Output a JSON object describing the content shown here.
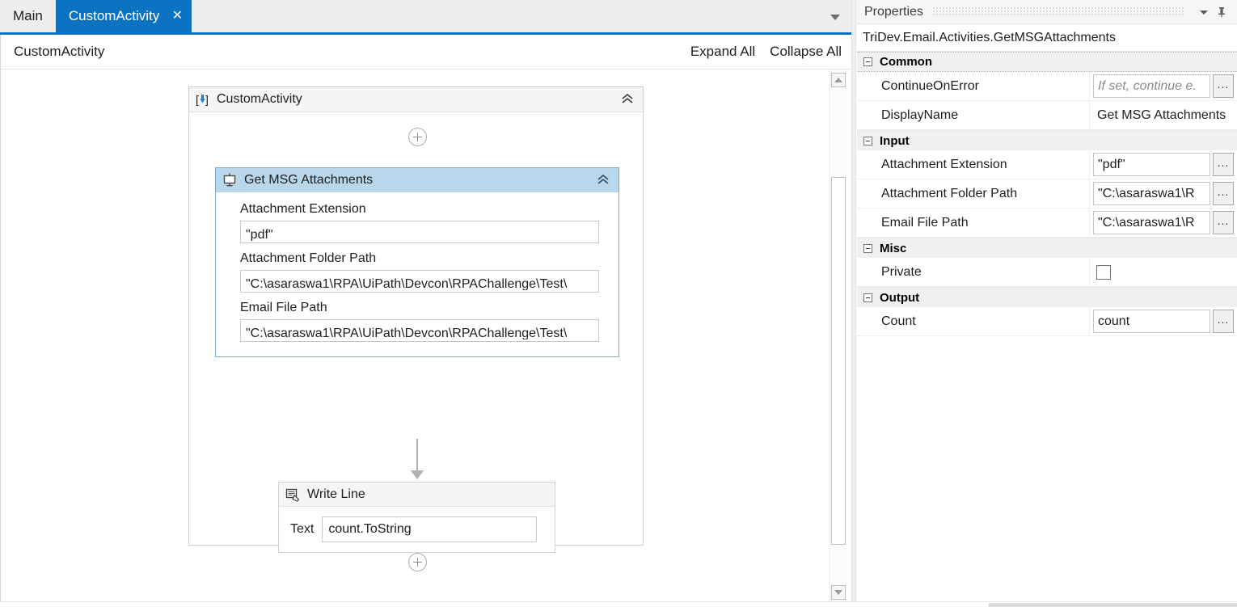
{
  "tabs": [
    {
      "label": "Main",
      "active": false,
      "closable": false
    },
    {
      "label": "CustomActivity",
      "active": true,
      "closable": true,
      "close_glyph": "✕"
    }
  ],
  "tab_overflow_icon": "chevron-down-icon",
  "designer": {
    "breadcrumb": "CustomActivity",
    "expand_all_label": "Expand All",
    "collapse_all_label": "Collapse All",
    "sequence": {
      "title": "CustomActivity",
      "icon": "sequence-icon",
      "collapse_glyph": "«"
    },
    "activity_getmsg": {
      "title": "Get MSG Attachments",
      "icon": "get-msg-attachments-icon",
      "collapse_glyph": "«",
      "fields": [
        {
          "label": "Attachment Extension",
          "value": "\"pdf\""
        },
        {
          "label": "Attachment Folder Path",
          "value": "\"C:\\asaraswa1\\RPA\\UiPath\\Devcon\\RPAChallenge\\Test\\"
        },
        {
          "label": "Email File Path",
          "value": "\"C:\\asaraswa1\\RPA\\UiPath\\Devcon\\RPAChallenge\\Test\\"
        }
      ]
    },
    "activity_writeline": {
      "title": "Write Line",
      "icon": "write-line-icon",
      "text_label": "Text",
      "text_value": "count.ToString"
    }
  },
  "properties": {
    "panel_title": "Properties",
    "dropdown_icon": "chevron-down-icon",
    "pin_icon": "pin-icon",
    "subtitle": "TriDev.Email.Activities.GetMSGAttachments",
    "ellipsis_label": "...",
    "categories": [
      {
        "name": "Common",
        "rows": [
          {
            "name": "ContinueOnError",
            "value": "If set, continue e.",
            "is_placeholder": true,
            "has_ellipsis": true,
            "type": "text"
          },
          {
            "name": "DisplayName",
            "value": "Get MSG Attachments",
            "is_placeholder": false,
            "has_ellipsis": false,
            "type": "text-borderless"
          }
        ]
      },
      {
        "name": "Input",
        "rows": [
          {
            "name": "Attachment Extension",
            "value": "\"pdf\"",
            "is_placeholder": false,
            "has_ellipsis": true,
            "type": "text"
          },
          {
            "name": "Attachment Folder Path",
            "value": "\"C:\\asaraswa1\\R",
            "is_placeholder": false,
            "has_ellipsis": true,
            "type": "text"
          },
          {
            "name": "Email File Path",
            "value": "\"C:\\asaraswa1\\R",
            "is_placeholder": false,
            "has_ellipsis": true,
            "type": "text"
          }
        ]
      },
      {
        "name": "Misc",
        "rows": [
          {
            "name": "Private",
            "value": "",
            "checked": false,
            "has_ellipsis": false,
            "type": "checkbox"
          }
        ]
      },
      {
        "name": "Output",
        "rows": [
          {
            "name": "Count",
            "value": "count",
            "is_placeholder": false,
            "has_ellipsis": true,
            "type": "text"
          }
        ]
      }
    ]
  },
  "colors": {
    "accent": "#0c73c2",
    "selected_activity_header": "#b9d7ea",
    "selected_activity_border": "#7fa8c9",
    "panel_bg": "#f6f6f6"
  }
}
